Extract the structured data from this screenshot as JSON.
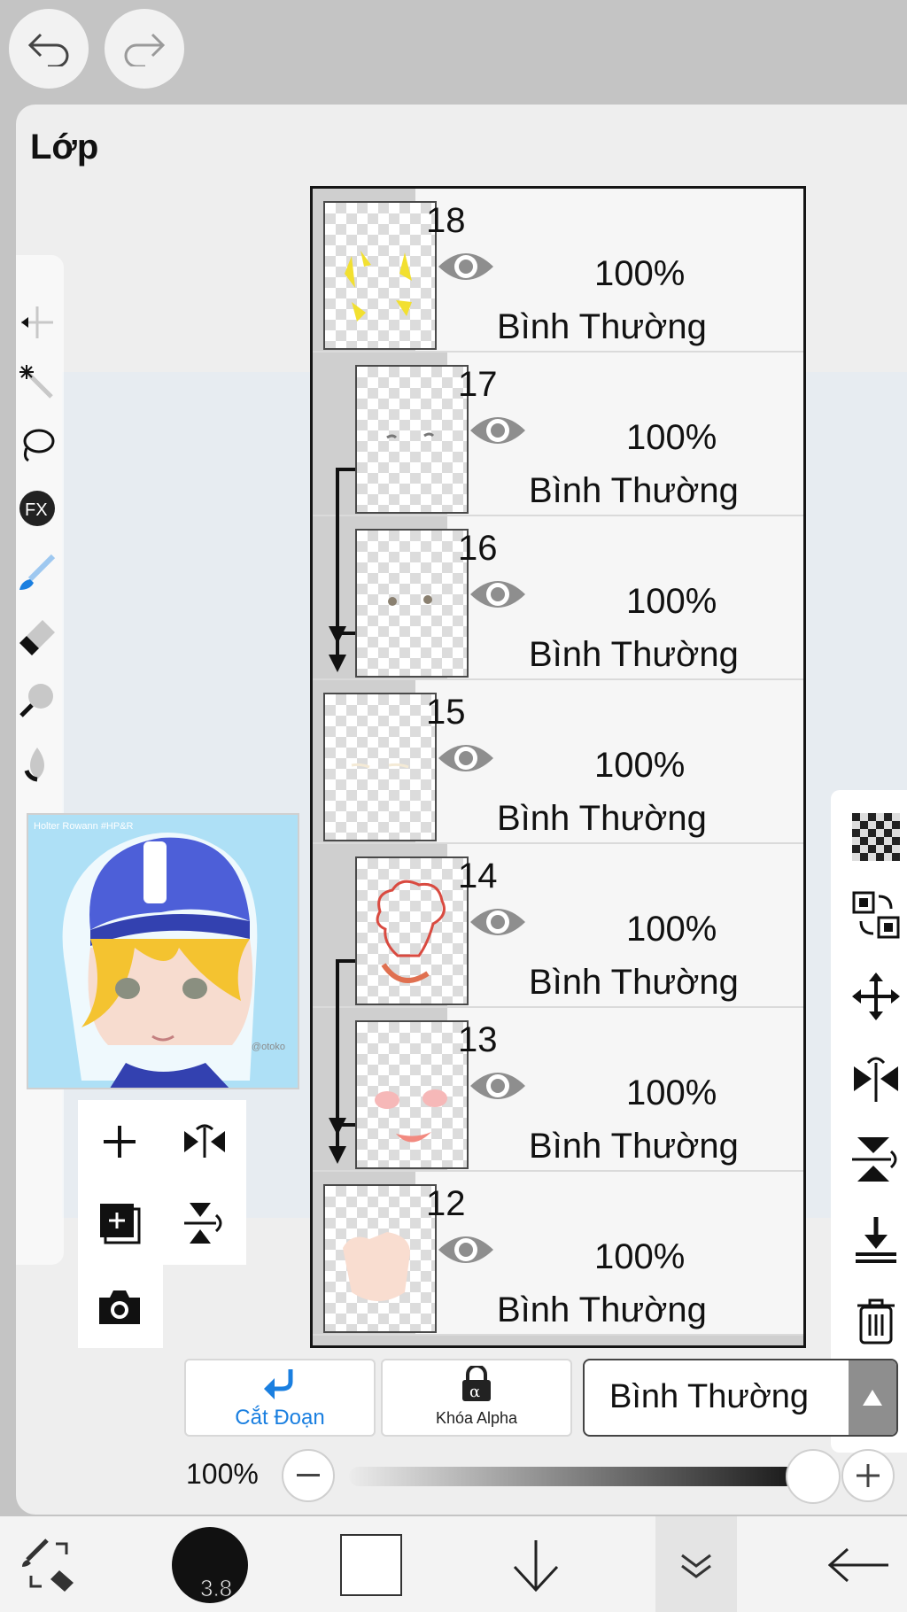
{
  "panel": {
    "title": "Lớp"
  },
  "preview": {
    "watermark": "Holter Rowann #HP&R",
    "signature": "@otoko"
  },
  "layers": [
    {
      "number": "18",
      "opacity": "100%",
      "blend": "Bình Thường",
      "clipped": false
    },
    {
      "number": "17",
      "opacity": "100%",
      "blend": "Bình Thường",
      "clipped": true
    },
    {
      "number": "16",
      "opacity": "100%",
      "blend": "Bình Thường",
      "clipped": true
    },
    {
      "number": "15",
      "opacity": "100%",
      "blend": "Bình Thường",
      "clipped": false
    },
    {
      "number": "14",
      "opacity": "100%",
      "blend": "Bình Thường",
      "clipped": true
    },
    {
      "number": "13",
      "opacity": "100%",
      "blend": "Bình Thường",
      "clipped": true
    },
    {
      "number": "12",
      "opacity": "100%",
      "blend": "Bình Thường",
      "clipped": false
    }
  ],
  "bottom_controls": {
    "clip_label": "Cắt Đoạn",
    "alpha_lock_label": "Khóa Alpha",
    "blend_mode": "Bình Thường",
    "opacity_label": "100%",
    "opacity_value": 1.0
  },
  "brush_size": "3.8",
  "colors": {
    "accent": "#1a7fe0",
    "selected_color": "#ffffff",
    "brush_circle": "#111111"
  }
}
